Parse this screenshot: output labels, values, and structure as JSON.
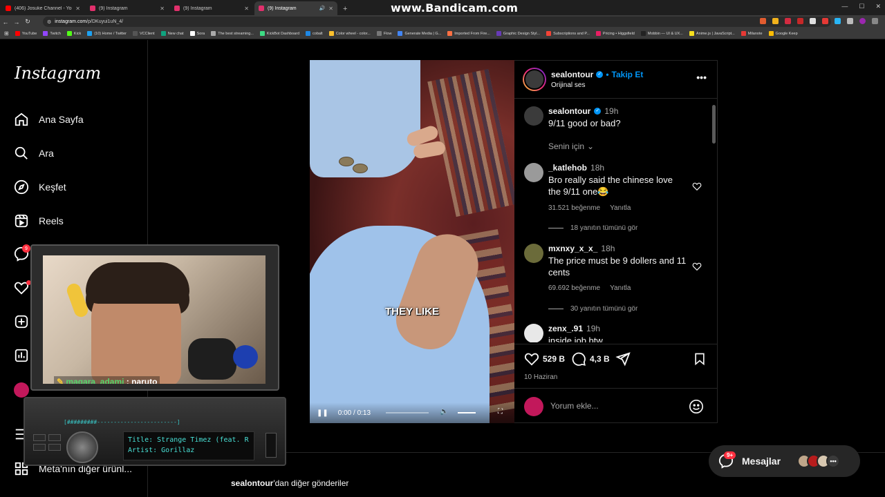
{
  "browser": {
    "tabs": [
      {
        "title": "(406) Josuke Channel - YouTub",
        "color": "#ff0000"
      },
      {
        "title": "(9) Instagram",
        "color": "#e1306c"
      },
      {
        "title": "(9) Instagram",
        "color": "#e1306c"
      },
      {
        "title": "(9) Instagram",
        "color": "#e1306c",
        "active": true
      }
    ],
    "url_host": "instagram.com",
    "url_path": "/p/DKuyui1uN_4/",
    "watermark": "www.Bandicam.com",
    "bookmarks": [
      "YouTube",
      "Twitch",
      "Kick",
      "(10) Home / Twitter",
      "VCClient",
      "New chat",
      "Sora",
      "The best streaming...",
      "KickBot Dashboard",
      "cobalt",
      "Color wheel - color...",
      "Flow",
      "Generate Media | G...",
      "Imported From Fire...",
      "Graphic Design Styl...",
      "Subscriptions and P...",
      "Pricing • Higgsfield",
      "Mobbin — UI & UX...",
      "Anime.js | JavaScript...",
      "Milanote",
      "Google Keep"
    ]
  },
  "sidebar": {
    "logo": "Instagram",
    "items": [
      {
        "label": "Ana Sayfa",
        "icon": "home-icon"
      },
      {
        "label": "Ara",
        "icon": "search-icon"
      },
      {
        "label": "Keşfet",
        "icon": "explore-icon"
      },
      {
        "label": "Reels",
        "icon": "reels-icon"
      }
    ],
    "badge": "9",
    "more_label": "Meta'nın diğer ürünl..."
  },
  "post": {
    "author": "sealontour",
    "follow_label": "Takip Et",
    "audio": "Orijinal ses",
    "caption_time": "19h",
    "caption": "9/11 good or bad?",
    "sort_label": "Senin için",
    "video_caption": "THEY LIKE",
    "video_time": "0:00 / 0:13",
    "comments": [
      {
        "user": "_katlehob",
        "time": "18h",
        "text": "Bro really said the chinese love the 9/11 one😂",
        "likes": "31.521 beğenme",
        "reply": "Yanıtla",
        "replies": "18 yanıtın tümünü gör"
      },
      {
        "user": "mxnxy_x_x_",
        "time": "18h",
        "text": "The price must be 9 dollers and 11 cents",
        "likes": "69.692 beğenme",
        "reply": "Yanıtla",
        "replies": "30 yanıtın tümünü gör"
      },
      {
        "user": "zenx_.91",
        "time": "19h",
        "text": "inside job btw"
      }
    ],
    "like_count": "529 B",
    "comment_count": "4,3 B",
    "date": "10 Haziran",
    "add_comment_placeholder": "Yorum ekle..."
  },
  "more_posts": {
    "user": "sealontour",
    "suffix": "'dan diğer gönderiler"
  },
  "messages": {
    "label": "Mesajlar",
    "badge": "9+"
  },
  "overlay": {
    "chat_user": "magara_adami",
    "chat_sep": " : ",
    "chat_msg": "naruto",
    "eq_bar": "[#########------------------------]",
    "song_title": "Title: Strange Timez (feat. R",
    "song_artist": "Artist: Gorillaz"
  }
}
